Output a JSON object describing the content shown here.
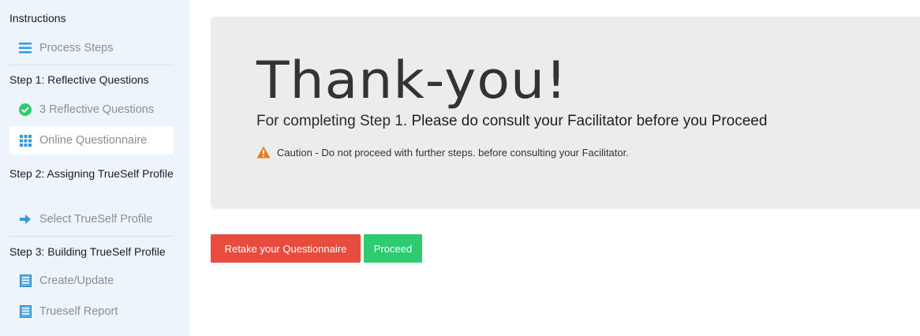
{
  "sidebar": {
    "sections": [
      {
        "title": "Instructions"
      },
      {
        "title": "Step 1: Reflective Questions"
      },
      {
        "title": "Step 2: Assigning TrueSelf Profile"
      },
      {
        "title": "Step 3: Building TrueSelf Profile"
      }
    ],
    "items": [
      {
        "label": "Process Steps",
        "icon": "list-icon"
      },
      {
        "label": "3 Reflective Questions",
        "icon": "check-circle-icon"
      },
      {
        "label": "Online Questionnaire",
        "icon": "grid-icon"
      },
      {
        "label": "Select TrueSelf Profile",
        "icon": "arrow-right-icon"
      },
      {
        "label": "Create/Update",
        "icon": "document-icon"
      },
      {
        "label": "Trueself Report",
        "icon": "document-icon"
      }
    ]
  },
  "main": {
    "heading": "Thank-you!",
    "subline_plain": "For completing Step 1.",
    "subline_bold": "Please do consult your Facilitator before you Proceed",
    "caution_label": "Caution -",
    "caution_text": "Do not proceed with further steps. before consulting your Facilitator."
  },
  "buttons": {
    "retake": "Retake your Questionnaire",
    "proceed": "Proceed"
  },
  "colors": {
    "sidebar_bg": "#edf4fb",
    "accent_blue": "#3498db",
    "success_green": "#2ecc71",
    "danger_red": "#e74c3c",
    "warning_orange": "#e67e22"
  }
}
